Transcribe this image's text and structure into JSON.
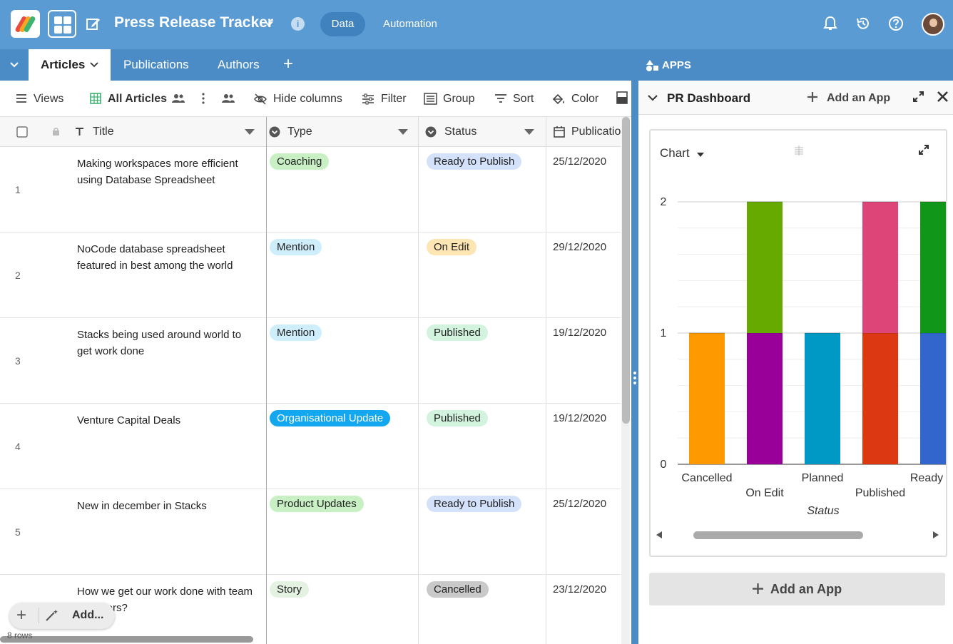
{
  "header": {
    "app_title": "Press Release Tracker",
    "info_label": "i",
    "nav_data": "Data",
    "nav_automation": "Automation"
  },
  "tabs": [
    {
      "label": "Articles",
      "active": true
    },
    {
      "label": "Publications",
      "active": false
    },
    {
      "label": "Authors",
      "active": false
    }
  ],
  "tab_add": "+",
  "toolbar": {
    "views": "Views",
    "view_name": "All Articles",
    "hide_columns": "Hide columns",
    "filter": "Filter",
    "group": "Group",
    "sort": "Sort",
    "color": "Color"
  },
  "columns": {
    "title": "Title",
    "type": "Type",
    "status": "Status",
    "publication": "Publication"
  },
  "rows": [
    {
      "num": "1",
      "title": "Making workspaces more efficient using Database Spreadsheet",
      "type": "Coaching",
      "status": "Ready to Publish",
      "date": "25/12/2020"
    },
    {
      "num": "2",
      "title": "NoCode database spreadsheet featured in best among the world",
      "type": "Mention",
      "status": "On Edit",
      "date": "29/12/2020"
    },
    {
      "num": "3",
      "title": "Stacks being used around world to get work done",
      "type": "Mention",
      "status": "Published",
      "date": "19/12/2020"
    },
    {
      "num": "4",
      "title": "Venture Capital Deals",
      "type": "Organisational Update",
      "status": "Published",
      "date": "19/12/2020"
    },
    {
      "num": "5",
      "title": "New in december in Stacks",
      "type": "Product Updates",
      "status": "Ready to Publish",
      "date": "25/12/2020"
    },
    {
      "num": "",
      "title": "How we get our work done with team members?",
      "type": "Story",
      "status": "Cancelled",
      "date": "23/12/2020"
    }
  ],
  "pill_colors": {
    "Coaching": {
      "bg": "#c8f0c4",
      "fg": "#222"
    },
    "Mention": {
      "bg": "#cfeefb",
      "fg": "#222"
    },
    "Organisational Update": {
      "bg": "#12a7ef",
      "fg": "#ffffff"
    },
    "Product Updates": {
      "bg": "#c8f0c4",
      "fg": "#222"
    },
    "Story": {
      "bg": "#e3f2e1",
      "fg": "#222"
    },
    "Ready to Publish": {
      "bg": "#d4e1fb",
      "fg": "#222"
    },
    "On Edit": {
      "bg": "#fde5b4",
      "fg": "#222"
    },
    "Published": {
      "bg": "#d2f3dd",
      "fg": "#222"
    },
    "Cancelled": {
      "bg": "#c9c9c9",
      "fg": "#222"
    }
  },
  "footer": {
    "add_label": "Add...",
    "row_count": "8 rows"
  },
  "apps": {
    "heading": "APPS",
    "dashboard_title": "PR Dashboard",
    "add_app_small": "Add an App",
    "chart_selector": "Chart",
    "add_app_big": "Add an App"
  },
  "chart_data": {
    "type": "bar",
    "stacked": true,
    "categories": [
      "Cancelled",
      "On Edit",
      "Planned",
      "Published",
      "Ready to F"
    ],
    "segments": [
      [
        {
          "value": 1,
          "color": "#ff9900"
        }
      ],
      [
        {
          "value": 1,
          "color": "#990099"
        },
        {
          "value": 1,
          "color": "#66aa00"
        }
      ],
      [
        {
          "value": 1,
          "color": "#0099c6"
        }
      ],
      [
        {
          "value": 1,
          "color": "#dc3912"
        },
        {
          "value": 1,
          "color": "#dd4477"
        }
      ],
      [
        {
          "value": 1,
          "color": "#3366cc"
        },
        {
          "value": 1,
          "color": "#109618"
        }
      ]
    ],
    "y_ticks": [
      "0",
      "1",
      "2"
    ],
    "ylim": [
      0,
      2
    ],
    "xlabel": "Status",
    "grid": true
  }
}
